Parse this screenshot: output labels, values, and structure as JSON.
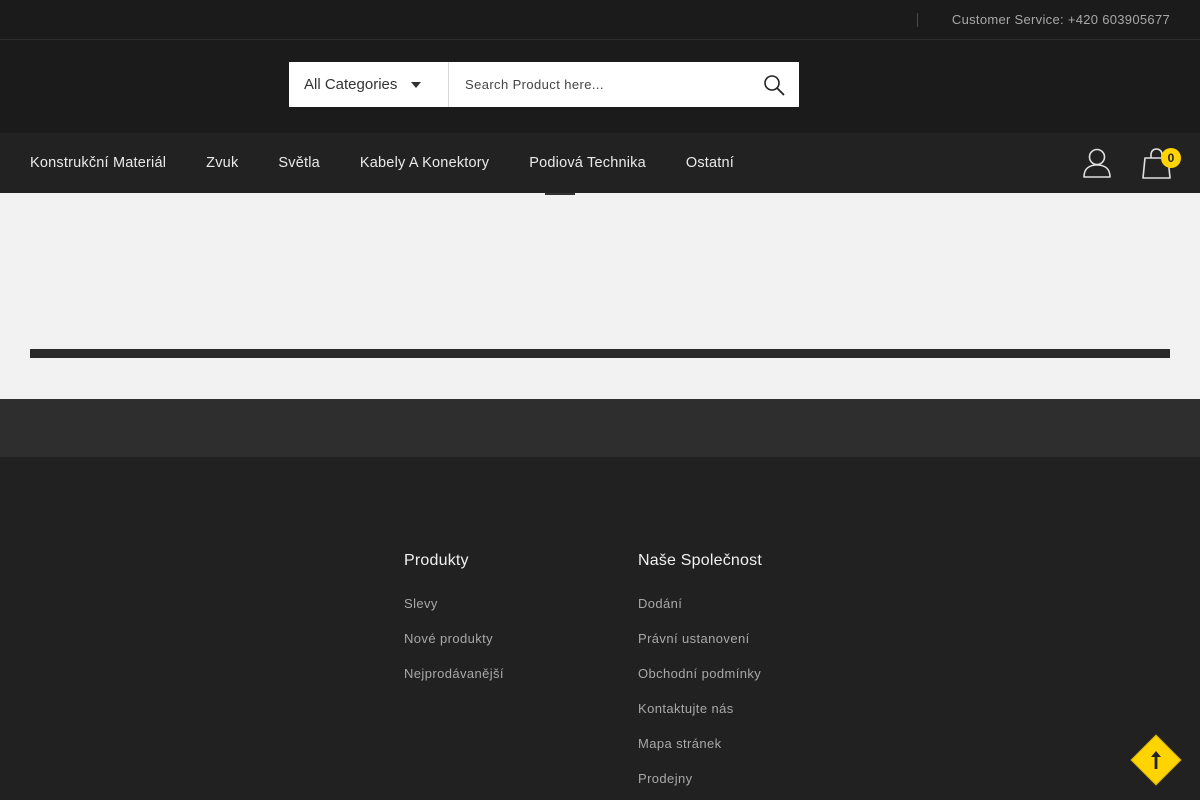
{
  "topbar": {
    "customer_service": "Customer Service: +420 603905677"
  },
  "search": {
    "category_label": "All Categories",
    "placeholder": "Search Product here..."
  },
  "nav": {
    "items": [
      {
        "label": "Konstrukční Materiál"
      },
      {
        "label": "Zvuk"
      },
      {
        "label": "Světla"
      },
      {
        "label": "Kabely A Konektory"
      },
      {
        "label": "Podiová Technika"
      },
      {
        "label": "Ostatní"
      }
    ],
    "cart_count": "0"
  },
  "footer": {
    "products": {
      "title": "Produkty",
      "links": [
        "Slevy",
        "Nové produkty",
        "Nejprodávanější"
      ]
    },
    "company": {
      "title": "Naše Společnost",
      "links": [
        "Dodání",
        "Právní ustanovení",
        "Obchodní podmínky",
        "Kontaktujte nás",
        "Mapa stránek",
        "Prodejny"
      ]
    }
  },
  "colors": {
    "accent": "#ffd400",
    "dark": "#212121"
  },
  "icons": [
    "search-icon",
    "caret-down-icon",
    "user-icon",
    "cart-icon",
    "arrow-up-icon"
  ]
}
